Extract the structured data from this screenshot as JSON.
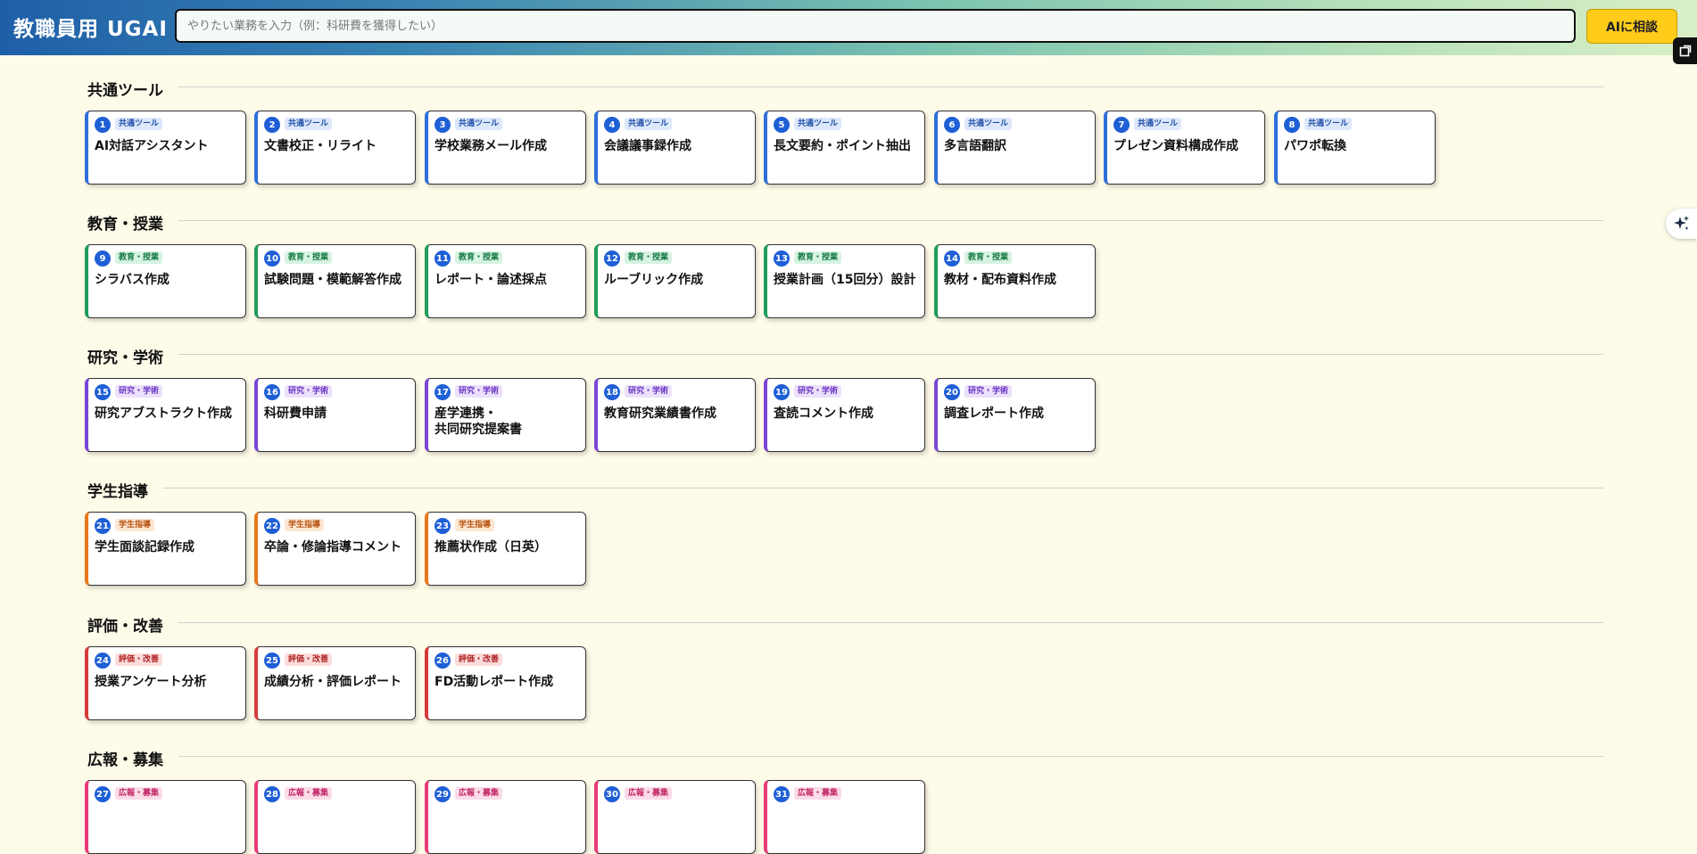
{
  "app": {
    "title": "教職員用 UGAI"
  },
  "search": {
    "placeholder": "やりたい業務を入力（例：科研費を獲得したい）"
  },
  "consult_button": {
    "label": "AIに相談"
  },
  "colors": {
    "common": "#2f6fdc",
    "education": "#1f9d5a",
    "research": "#7a46d6",
    "guidance": "#e8781c",
    "evaluation": "#d63b3b",
    "pr": "#e83b7a"
  },
  "sections": [
    {
      "title": "共通ツール",
      "key": "common",
      "tag_bg": "#dde8fb",
      "tag_fg": "#1f4fa8",
      "items": [
        {
          "num": "1",
          "tag": "共通ツール",
          "label": "AI対話アシスタント"
        },
        {
          "num": "2",
          "tag": "共通ツール",
          "label": "文書校正・リライト"
        },
        {
          "num": "3",
          "tag": "共通ツール",
          "label": "学校業務メール作成"
        },
        {
          "num": "4",
          "tag": "共通ツール",
          "label": "会議議事録作成"
        },
        {
          "num": "5",
          "tag": "共通ツール",
          "label": "長文要約・ポイント抽出"
        },
        {
          "num": "6",
          "tag": "共通ツール",
          "label": "多言語翻訳"
        },
        {
          "num": "7",
          "tag": "共通ツール",
          "label": "プレゼン資料構成作成"
        },
        {
          "num": "8",
          "tag": "共通ツール",
          "label": "パワポ転換"
        }
      ]
    },
    {
      "title": "教育・授業",
      "key": "education",
      "tag_bg": "#d7f3e2",
      "tag_fg": "#157a44",
      "items": [
        {
          "num": "9",
          "tag": "教育・授業",
          "label": "シラバス作成"
        },
        {
          "num": "10",
          "tag": "教育・授業",
          "label": "試験問題・模範解答作成"
        },
        {
          "num": "11",
          "tag": "教育・授業",
          "label": "レポート・論述採点"
        },
        {
          "num": "12",
          "tag": "教育・授業",
          "label": "ルーブリック作成"
        },
        {
          "num": "13",
          "tag": "教育・授業",
          "label": "授業計画（15回分）設計"
        },
        {
          "num": "14",
          "tag": "教育・授業",
          "label": "教材・配布資料作成"
        }
      ]
    },
    {
      "title": "研究・学術",
      "key": "research",
      "tag_bg": "#ece1fb",
      "tag_fg": "#6a34c4",
      "items": [
        {
          "num": "15",
          "tag": "研究・学術",
          "label": "研究アブストラクト作成"
        },
        {
          "num": "16",
          "tag": "研究・学術",
          "label": "科研費申請"
        },
        {
          "num": "17",
          "tag": "研究・学術",
          "label": "産学連携・\n共同研究提案書"
        },
        {
          "num": "18",
          "tag": "研究・学術",
          "label": "教育研究業績書作成"
        },
        {
          "num": "19",
          "tag": "研究・学術",
          "label": "査読コメント作成"
        },
        {
          "num": "20",
          "tag": "研究・学術",
          "label": "調査レポート作成"
        }
      ]
    },
    {
      "title": "学生指導",
      "key": "guidance",
      "tag_bg": "#fde6d2",
      "tag_fg": "#b85410",
      "items": [
        {
          "num": "21",
          "tag": "学生指導",
          "label": "学生面談記録作成"
        },
        {
          "num": "22",
          "tag": "学生指導",
          "label": "卒論・修論指導コメント"
        },
        {
          "num": "23",
          "tag": "学生指導",
          "label": "推薦状作成（日英）"
        }
      ]
    },
    {
      "title": "評価・改善",
      "key": "evaluation",
      "tag_bg": "#fbdcdc",
      "tag_fg": "#b02424",
      "items": [
        {
          "num": "24",
          "tag": "評価・改善",
          "label": "授業アンケート分析"
        },
        {
          "num": "25",
          "tag": "評価・改善",
          "label": "成績分析・評価レポート"
        },
        {
          "num": "26",
          "tag": "評価・改善",
          "label": "FD活動レポート作成"
        }
      ]
    },
    {
      "title": "広報・募集",
      "key": "pr",
      "tag_bg": "#fcdbe8",
      "tag_fg": "#c02462",
      "items": [
        {
          "num": "27",
          "tag": "広報・募集",
          "label": ""
        },
        {
          "num": "28",
          "tag": "広報・募集",
          "label": ""
        },
        {
          "num": "29",
          "tag": "広報・募集",
          "label": ""
        },
        {
          "num": "30",
          "tag": "広報・募集",
          "label": ""
        },
        {
          "num": "31",
          "tag": "広報・募集",
          "label": ""
        }
      ]
    }
  ]
}
